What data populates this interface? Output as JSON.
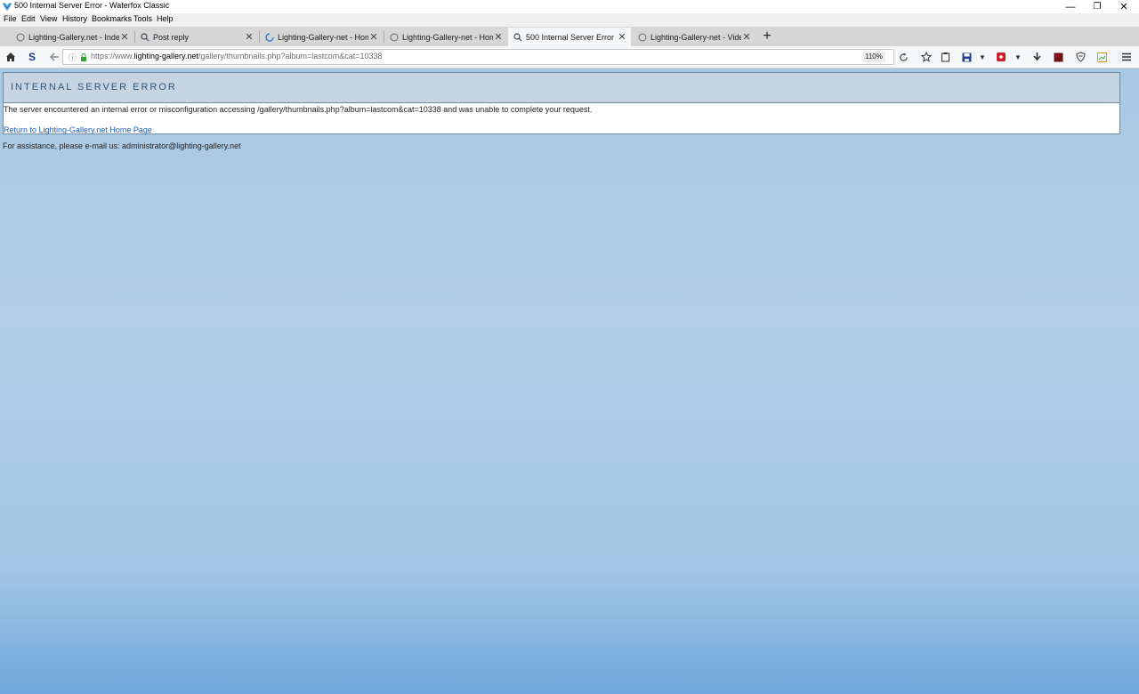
{
  "window": {
    "title": "500 Internal Server Error - Waterfox Classic",
    "controls": {
      "minimize": "—",
      "restore": "❐",
      "close": "✕"
    }
  },
  "menu": [
    "File",
    "Edit",
    "View",
    "History",
    "Bookmarks",
    "Tools",
    "Help"
  ],
  "tabs": [
    {
      "label": "Lighting-Gallery.net - Index",
      "icon": "loading-icon"
    },
    {
      "label": "Post reply",
      "icon": "site-favicon"
    },
    {
      "label": "Lighting-Gallery-net - Home",
      "icon": "loading-spinner-icon"
    },
    {
      "label": "Lighting-Gallery-net - Home",
      "icon": "loading-icon"
    },
    {
      "label": "500 Internal Server Error",
      "icon": "site-favicon",
      "active": true
    },
    {
      "label": "Lighting-Gallery-net - Videos",
      "icon": "loading-icon"
    }
  ],
  "newtab_label": "+",
  "toolbar": {
    "url_prefix": "https://www.",
    "url_domain": "lighting-gallery.net",
    "url_path": "/gallery/thumbnails.php?album=lastcom&cat=10338",
    "zoom": "110%",
    "s_label": "S"
  },
  "page": {
    "heading": "INTERNAL SERVER ERROR",
    "message": "The server encountered an internal error or misconfiguration accessing /gallery/thumbnails.php?album=lastcom&cat=10338 and was unable to complete your request.",
    "return_link": "Return to Lighting-Gallery.net Home Page",
    "assistance": "For assistance, please e-mail us: administrator@lighting-gallery.net"
  },
  "colors": {
    "heading": "#2f5577",
    "header_bg": "#c7d5e3",
    "link": "#1f5bb5",
    "page_bg_top": "#a9c8e3",
    "page_bg_bottom": "#6ea8dc"
  }
}
